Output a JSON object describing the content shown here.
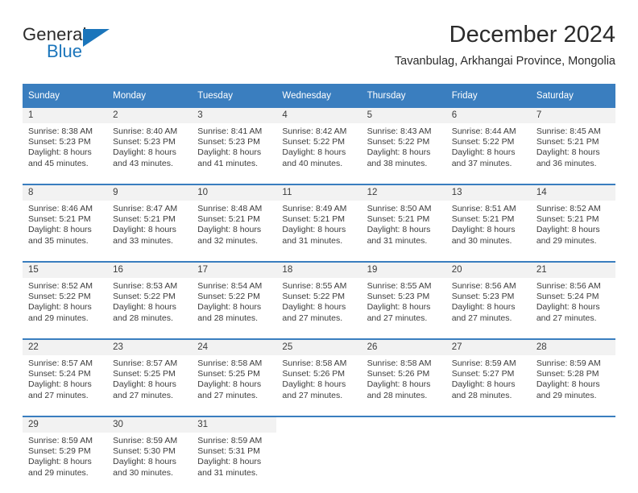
{
  "brand": {
    "name_top": "General",
    "name_bottom": "Blue",
    "color_primary": "#1b75bb",
    "color_text": "#2b2b2b"
  },
  "header": {
    "title": "December 2024",
    "subtitle": "Tavanbulag, Arkhangai Province, Mongolia",
    "header_bg": "#3a7ebf",
    "header_text_color": "#ffffff",
    "daynum_bg": "#f2f2f2"
  },
  "calendar": {
    "weekday_headers": [
      "Sunday",
      "Monday",
      "Tuesday",
      "Wednesday",
      "Thursday",
      "Friday",
      "Saturday"
    ],
    "weeks": [
      [
        {
          "day": "1",
          "sunrise": "Sunrise: 8:38 AM",
          "sunset": "Sunset: 5:23 PM",
          "daylight1": "Daylight: 8 hours",
          "daylight2": "and 45 minutes."
        },
        {
          "day": "2",
          "sunrise": "Sunrise: 8:40 AM",
          "sunset": "Sunset: 5:23 PM",
          "daylight1": "Daylight: 8 hours",
          "daylight2": "and 43 minutes."
        },
        {
          "day": "3",
          "sunrise": "Sunrise: 8:41 AM",
          "sunset": "Sunset: 5:23 PM",
          "daylight1": "Daylight: 8 hours",
          "daylight2": "and 41 minutes."
        },
        {
          "day": "4",
          "sunrise": "Sunrise: 8:42 AM",
          "sunset": "Sunset: 5:22 PM",
          "daylight1": "Daylight: 8 hours",
          "daylight2": "and 40 minutes."
        },
        {
          "day": "5",
          "sunrise": "Sunrise: 8:43 AM",
          "sunset": "Sunset: 5:22 PM",
          "daylight1": "Daylight: 8 hours",
          "daylight2": "and 38 minutes."
        },
        {
          "day": "6",
          "sunrise": "Sunrise: 8:44 AM",
          "sunset": "Sunset: 5:22 PM",
          "daylight1": "Daylight: 8 hours",
          "daylight2": "and 37 minutes."
        },
        {
          "day": "7",
          "sunrise": "Sunrise: 8:45 AM",
          "sunset": "Sunset: 5:21 PM",
          "daylight1": "Daylight: 8 hours",
          "daylight2": "and 36 minutes."
        }
      ],
      [
        {
          "day": "8",
          "sunrise": "Sunrise: 8:46 AM",
          "sunset": "Sunset: 5:21 PM",
          "daylight1": "Daylight: 8 hours",
          "daylight2": "and 35 minutes."
        },
        {
          "day": "9",
          "sunrise": "Sunrise: 8:47 AM",
          "sunset": "Sunset: 5:21 PM",
          "daylight1": "Daylight: 8 hours",
          "daylight2": "and 33 minutes."
        },
        {
          "day": "10",
          "sunrise": "Sunrise: 8:48 AM",
          "sunset": "Sunset: 5:21 PM",
          "daylight1": "Daylight: 8 hours",
          "daylight2": "and 32 minutes."
        },
        {
          "day": "11",
          "sunrise": "Sunrise: 8:49 AM",
          "sunset": "Sunset: 5:21 PM",
          "daylight1": "Daylight: 8 hours",
          "daylight2": "and 31 minutes."
        },
        {
          "day": "12",
          "sunrise": "Sunrise: 8:50 AM",
          "sunset": "Sunset: 5:21 PM",
          "daylight1": "Daylight: 8 hours",
          "daylight2": "and 31 minutes."
        },
        {
          "day": "13",
          "sunrise": "Sunrise: 8:51 AM",
          "sunset": "Sunset: 5:21 PM",
          "daylight1": "Daylight: 8 hours",
          "daylight2": "and 30 minutes."
        },
        {
          "day": "14",
          "sunrise": "Sunrise: 8:52 AM",
          "sunset": "Sunset: 5:21 PM",
          "daylight1": "Daylight: 8 hours",
          "daylight2": "and 29 minutes."
        }
      ],
      [
        {
          "day": "15",
          "sunrise": "Sunrise: 8:52 AM",
          "sunset": "Sunset: 5:22 PM",
          "daylight1": "Daylight: 8 hours",
          "daylight2": "and 29 minutes."
        },
        {
          "day": "16",
          "sunrise": "Sunrise: 8:53 AM",
          "sunset": "Sunset: 5:22 PM",
          "daylight1": "Daylight: 8 hours",
          "daylight2": "and 28 minutes."
        },
        {
          "day": "17",
          "sunrise": "Sunrise: 8:54 AM",
          "sunset": "Sunset: 5:22 PM",
          "daylight1": "Daylight: 8 hours",
          "daylight2": "and 28 minutes."
        },
        {
          "day": "18",
          "sunrise": "Sunrise: 8:55 AM",
          "sunset": "Sunset: 5:22 PM",
          "daylight1": "Daylight: 8 hours",
          "daylight2": "and 27 minutes."
        },
        {
          "day": "19",
          "sunrise": "Sunrise: 8:55 AM",
          "sunset": "Sunset: 5:23 PM",
          "daylight1": "Daylight: 8 hours",
          "daylight2": "and 27 minutes."
        },
        {
          "day": "20",
          "sunrise": "Sunrise: 8:56 AM",
          "sunset": "Sunset: 5:23 PM",
          "daylight1": "Daylight: 8 hours",
          "daylight2": "and 27 minutes."
        },
        {
          "day": "21",
          "sunrise": "Sunrise: 8:56 AM",
          "sunset": "Sunset: 5:24 PM",
          "daylight1": "Daylight: 8 hours",
          "daylight2": "and 27 minutes."
        }
      ],
      [
        {
          "day": "22",
          "sunrise": "Sunrise: 8:57 AM",
          "sunset": "Sunset: 5:24 PM",
          "daylight1": "Daylight: 8 hours",
          "daylight2": "and 27 minutes."
        },
        {
          "day": "23",
          "sunrise": "Sunrise: 8:57 AM",
          "sunset": "Sunset: 5:25 PM",
          "daylight1": "Daylight: 8 hours",
          "daylight2": "and 27 minutes."
        },
        {
          "day": "24",
          "sunrise": "Sunrise: 8:58 AM",
          "sunset": "Sunset: 5:25 PM",
          "daylight1": "Daylight: 8 hours",
          "daylight2": "and 27 minutes."
        },
        {
          "day": "25",
          "sunrise": "Sunrise: 8:58 AM",
          "sunset": "Sunset: 5:26 PM",
          "daylight1": "Daylight: 8 hours",
          "daylight2": "and 27 minutes."
        },
        {
          "day": "26",
          "sunrise": "Sunrise: 8:58 AM",
          "sunset": "Sunset: 5:26 PM",
          "daylight1": "Daylight: 8 hours",
          "daylight2": "and 28 minutes."
        },
        {
          "day": "27",
          "sunrise": "Sunrise: 8:59 AM",
          "sunset": "Sunset: 5:27 PM",
          "daylight1": "Daylight: 8 hours",
          "daylight2": "and 28 minutes."
        },
        {
          "day": "28",
          "sunrise": "Sunrise: 8:59 AM",
          "sunset": "Sunset: 5:28 PM",
          "daylight1": "Daylight: 8 hours",
          "daylight2": "and 29 minutes."
        }
      ],
      [
        {
          "day": "29",
          "sunrise": "Sunrise: 8:59 AM",
          "sunset": "Sunset: 5:29 PM",
          "daylight1": "Daylight: 8 hours",
          "daylight2": "and 29 minutes."
        },
        {
          "day": "30",
          "sunrise": "Sunrise: 8:59 AM",
          "sunset": "Sunset: 5:30 PM",
          "daylight1": "Daylight: 8 hours",
          "daylight2": "and 30 minutes."
        },
        {
          "day": "31",
          "sunrise": "Sunrise: 8:59 AM",
          "sunset": "Sunset: 5:31 PM",
          "daylight1": "Daylight: 8 hours",
          "daylight2": "and 31 minutes."
        },
        {
          "day": "",
          "sunrise": "",
          "sunset": "",
          "daylight1": "",
          "daylight2": ""
        },
        {
          "day": "",
          "sunrise": "",
          "sunset": "",
          "daylight1": "",
          "daylight2": ""
        },
        {
          "day": "",
          "sunrise": "",
          "sunset": "",
          "daylight1": "",
          "daylight2": ""
        },
        {
          "day": "",
          "sunrise": "",
          "sunset": "",
          "daylight1": "",
          "daylight2": ""
        }
      ]
    ]
  }
}
